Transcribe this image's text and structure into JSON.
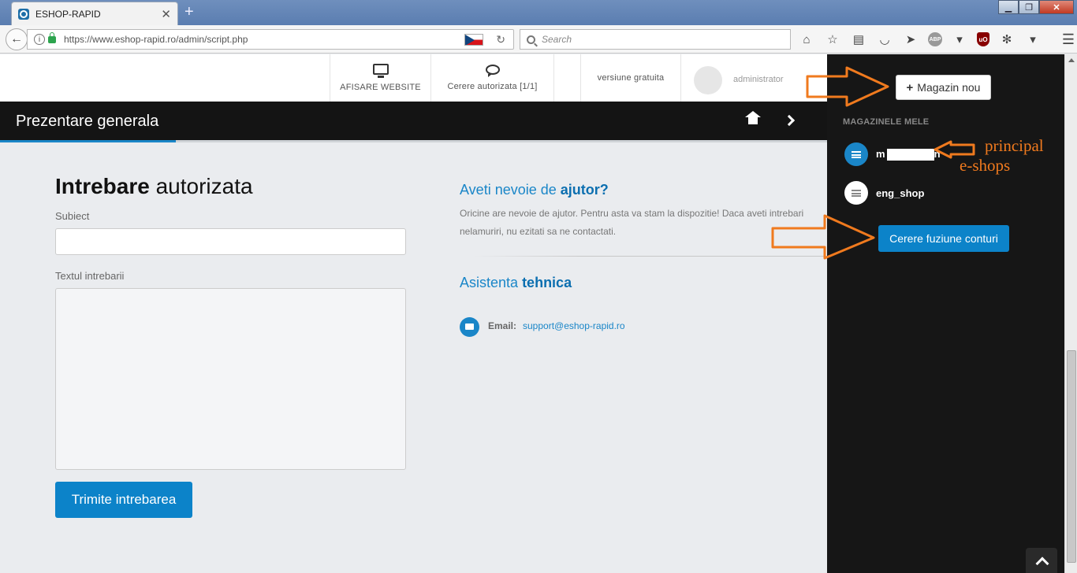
{
  "browser": {
    "tab_title": "ESHOP-RAPID",
    "url": "https://www.eshop-rapid.ro/admin/script.php",
    "search_placeholder": "Search",
    "abp_badge": "ABP",
    "ublock_badge": "uO"
  },
  "topnav": {
    "website_label": "AFISARE WEBSITE",
    "request_label": "Cerere autorizata [1/1]",
    "version_label": "versiune gratuita",
    "user_label": "administrator"
  },
  "header": {
    "title": "Prezentare generala"
  },
  "form": {
    "heading_bold": "Intrebare",
    "heading_rest": "autorizata",
    "subject_label": "Subiect",
    "subject_value": "",
    "body_label": "Textul intrebarii",
    "body_value": "",
    "submit_label": "Trimite intrebarea"
  },
  "help": {
    "heading_pre": "Aveti nevoie de",
    "heading_bold": "ajutor?",
    "text_line1": "Oricine are nevoie de ajutor. Pentru asta va stam la dispozitie! Daca aveti intrebari",
    "text_line2": "nelamuriri, nu ezitati sa ne contactati.",
    "support_heading_pre": "Asistenta",
    "support_heading_bold": "tehnica",
    "email_label": "Email:",
    "email_value": "support@eshop-rapid.ro"
  },
  "sidebar": {
    "new_shop_label": "Magazin nou",
    "shops_heading": "MAGAZINELE MELE",
    "shops": [
      {
        "name": "m",
        "name_suffix": "n",
        "active": true
      },
      {
        "name": "eng_shop",
        "active": false
      }
    ],
    "merge_label": "Cerere fuziune conturi"
  },
  "annotations": {
    "line1": "principal",
    "line2": "e-shops"
  },
  "colors": {
    "accent": "#1a86c8",
    "header_bg": "#141414",
    "sidebar_bg": "#161616",
    "annotation": "#f07a1e"
  }
}
